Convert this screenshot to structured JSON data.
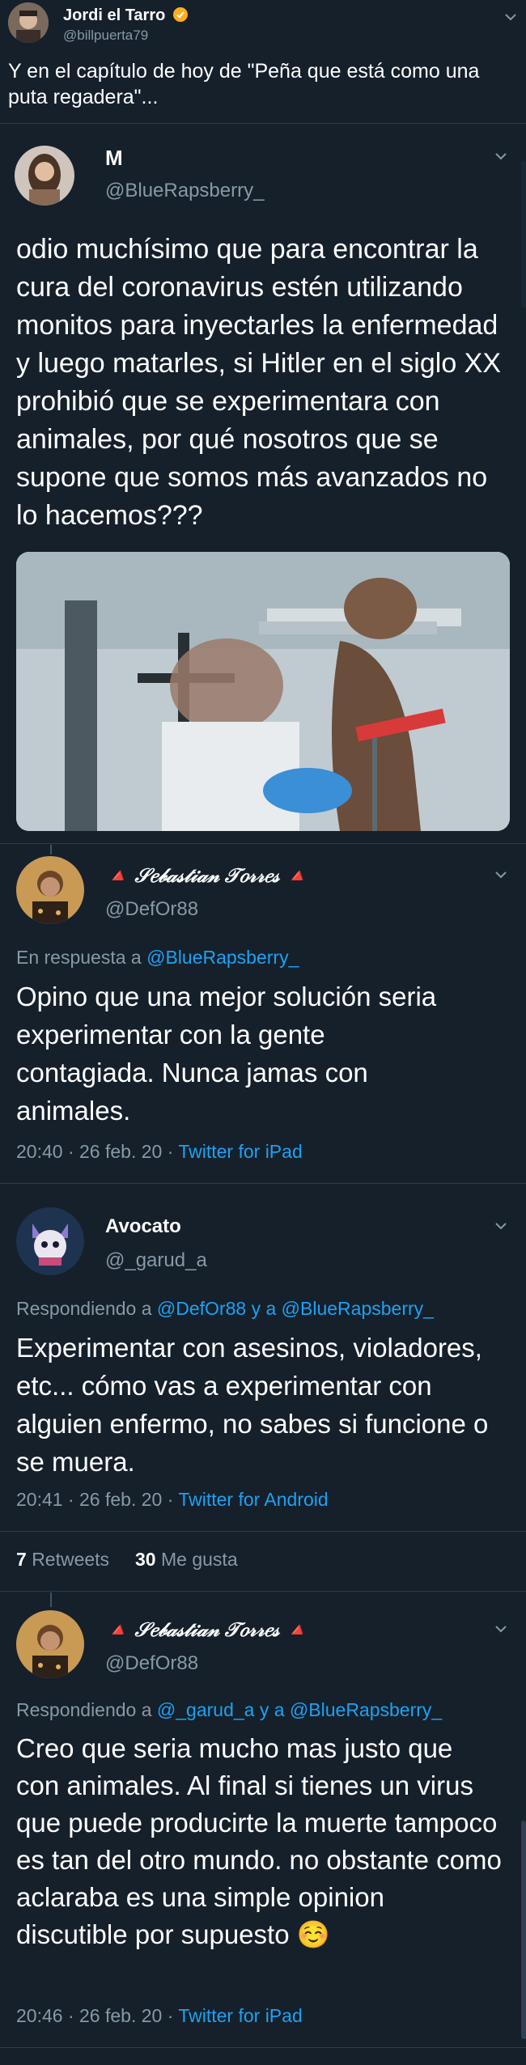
{
  "header": {
    "name": "Jordi el Tarro",
    "handle": "@billpuerta79",
    "text": "Y en el capítulo de hoy de \"Peña que está como una puta regadera\"..."
  },
  "quoted": {
    "name": "M",
    "handle": "@BlueRapsberry_",
    "text": "odio muchísimo que para encontrar la cura del coronavirus estén utilizando monitos para inyectarles la enfermedad y luego matarles, si Hitler en el siglo XX prohibió que se experimentara con animales, por qué nosotros que se supone que somos más avanzados no lo hacemos???"
  },
  "replies": [
    {
      "name": "🔺 𝒮𝑒𝒷𝒶𝓈𝓉𝒾𝒶𝓃 𝒯𝑜𝓇𝓇𝑒𝓈 🔺",
      "handle": "@DefOr88",
      "reply_prefix": "En respuesta a ",
      "reply_to": "@BlueRapsberry_",
      "text": "Opino que una mejor solución seria experimentar con la gente contagiada. Nunca jamas con animales.",
      "time": "20:40 · 26 feb. 20 · ",
      "source": "Twitter for iPad"
    },
    {
      "name": "Avocato",
      "handle": "@_garud_a",
      "reply_prefix": "Respondiendo a ",
      "reply_to": "@DefOr88 y a @BlueRapsberry_",
      "text": "Experimentar con asesinos, violadores, etc... cómo vas a experimentar con alguien enfermo, no sabes si funcione o se muera.",
      "time": "20:41 · 26 feb. 20 · ",
      "source": "Twitter for Android"
    },
    {
      "name": "🔺 𝒮𝑒𝒷𝒶𝓈𝓉𝒾𝒶𝓃 𝒯𝑜𝓇𝓇𝑒𝓈 🔺",
      "handle": "@DefOr88",
      "reply_prefix": "Respondiendo a ",
      "reply_to": "@_garud_a y a @BlueRapsberry_",
      "text": "Creo que seria mucho mas justo que con animales. Al final si tienes un virus que puede producirte la muerte tampoco es tan del otro mundo. no obstante como aclaraba es una simple opinion discutible por supuesto ☺️",
      "time": "20:46 · 26 feb. 20 · ",
      "source": "Twitter for iPad"
    }
  ],
  "stats": {
    "retweets_count": "7",
    "retweets_label": "Retweets",
    "likes_count": "30",
    "likes_label": "Me gusta"
  },
  "colors": {
    "background": "#15202b",
    "accent": "#1da1f2",
    "muted": "#8899a6",
    "verified": "#ffad1f"
  }
}
